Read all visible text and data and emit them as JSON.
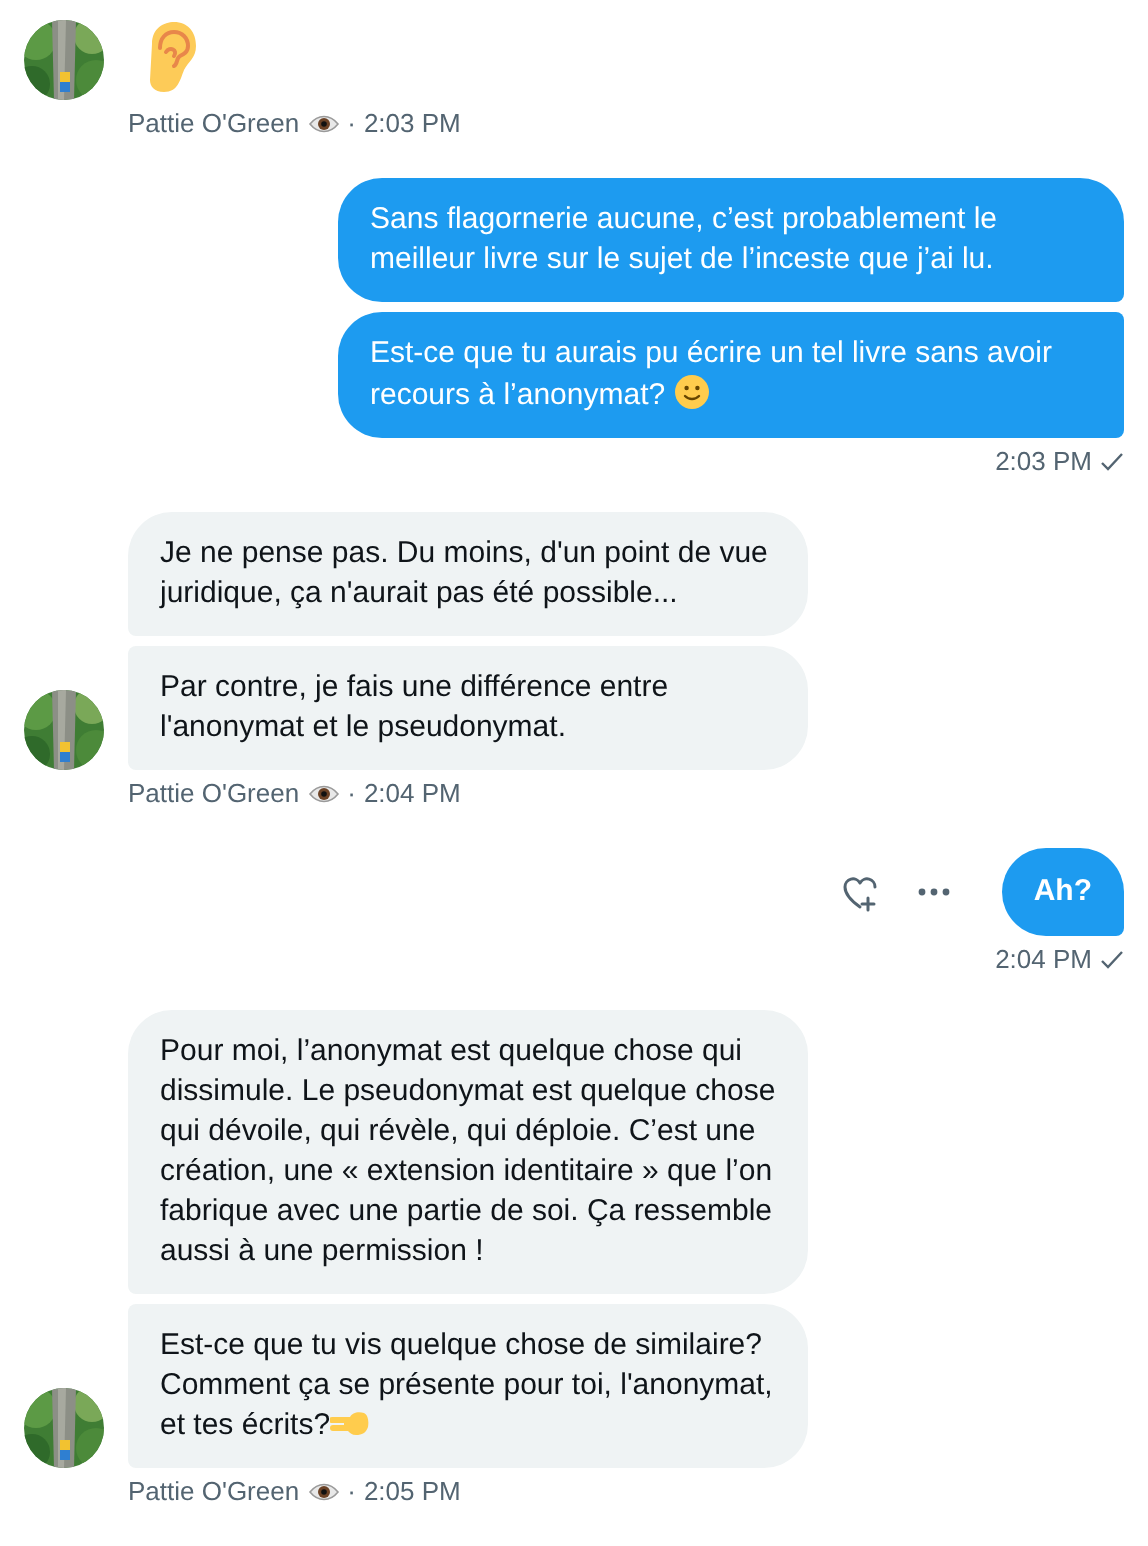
{
  "messages": [
    {
      "outgoing": false,
      "bubbles": [
        {
          "kind": "ear"
        }
      ],
      "sender": "Pattie O'Green",
      "separator": "·",
      "time": "2:03 PM"
    },
    {
      "outgoing": true,
      "bubbles": [
        {
          "kind": "text",
          "text": "Sans flagornerie aucune, c’est probablement le meilleur livre sur le sujet de l’inceste que j’ai lu."
        },
        {
          "kind": "smiling",
          "text": "Est-ce que tu aurais pu écrire un tel livre sans avoir recours à l’anonymat?"
        }
      ],
      "time": "2:03 PM",
      "seen": true,
      "actions": false
    },
    {
      "outgoing": false,
      "bubbles": [
        {
          "kind": "text",
          "text": "Je ne pense pas. Du moins, d'un point de vue juridique, ça n'aurait pas été possible..."
        },
        {
          "kind": "text",
          "text": "Par contre, je fais une différence entre l'anonymat et le pseudonymat."
        }
      ],
      "sender": "Pattie O'Green",
      "separator": "·",
      "time": "2:04 PM"
    },
    {
      "outgoing": true,
      "bubbles": [
        {
          "kind": "text",
          "text": "Ah?"
        }
      ],
      "time": "2:04 PM",
      "seen": true,
      "actions": true
    },
    {
      "outgoing": false,
      "bubbles": [
        {
          "kind": "text",
          "text": "Pour moi, l’anonymat est quelque chose qui dissimule. Le pseudonymat est quelque chose qui dévoile, qui révèle, qui déploie. C’est une création, une « extension identitaire » que l’on fabrique avec une partie de soi. Ça ressemble aussi à une permission !"
        },
        {
          "kind": "pointing",
          "text": "Est-ce que tu vis quelque chose de similaire? Comment ça se présente pour toi, l'anonymat, et tes écrits?"
        }
      ],
      "sender": "Pattie O'Green",
      "separator": "·",
      "time": "2:05 PM"
    }
  ]
}
